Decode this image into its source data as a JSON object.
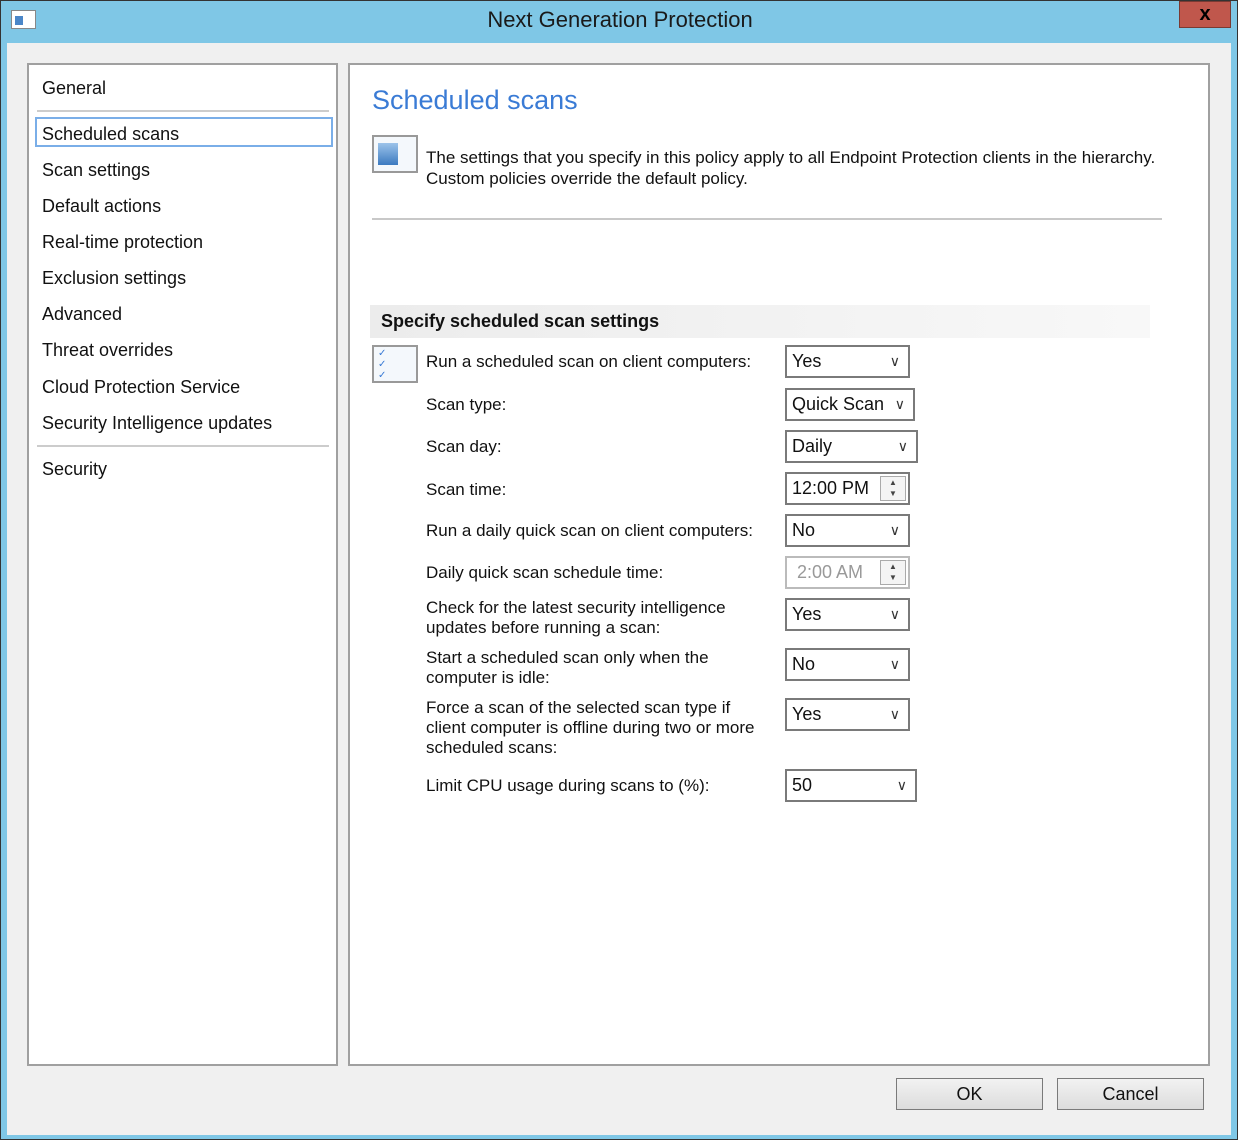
{
  "window": {
    "title": "Next Generation Protection",
    "close_label": "x"
  },
  "nav": {
    "items": [
      "General",
      "Scheduled scans",
      "Scan settings",
      "Default actions",
      "Real-time protection",
      "Exclusion settings",
      "Advanced",
      "Threat overrides",
      "Cloud Protection Service",
      "Security Intelligence updates",
      "Security"
    ],
    "selected": "Scheduled scans"
  },
  "main": {
    "title": "Scheduled scans",
    "info_line1": "The settings that you specify in this policy apply to all Endpoint Protection clients in the hierarchy.",
    "info_line2": "Custom policies override the default policy.",
    "section_title": "Specify scheduled scan settings",
    "settings": [
      {
        "label": "Run a scheduled scan on client computers:",
        "value": "Yes"
      },
      {
        "label": "Scan type:",
        "value": "Quick Scan"
      },
      {
        "label": "Scan day:",
        "value": "Daily"
      },
      {
        "label": "Scan time:",
        "value": "12:00 PM"
      },
      {
        "label": "Run a daily quick scan on client computers:",
        "value": "No"
      },
      {
        "label": "Daily quick scan schedule time:",
        "value": "2:00 AM"
      },
      {
        "label": "Check for the latest security intelligence updates before running a scan:",
        "value": "Yes"
      },
      {
        "label": "Start a scheduled scan only when the computer is idle:",
        "value": "No"
      },
      {
        "label": "Force a scan of the selected scan type if client computer is offline during two or more scheduled scans:",
        "value": "Yes"
      },
      {
        "label": "Limit CPU usage during scans to (%):",
        "value": "50"
      }
    ]
  },
  "buttons": {
    "ok": "OK",
    "cancel": "Cancel"
  }
}
